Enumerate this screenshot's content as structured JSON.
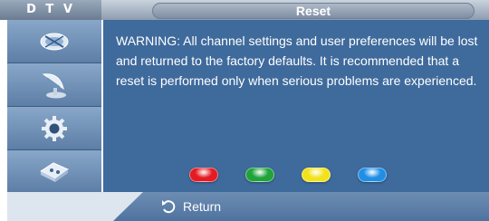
{
  "header": {
    "source_tab": "D T V",
    "title": "Reset"
  },
  "sidebar": {
    "items": [
      {
        "icon": "satellite-dish-icon"
      },
      {
        "icon": "antenna-icon"
      },
      {
        "icon": "gear-icon"
      },
      {
        "icon": "input-plug-icon"
      }
    ]
  },
  "main": {
    "warning_text": "WARNING: All channel settings and user preferences will be lost and returned to the factory defaults. It is recommended that a reset is performed only when serious problems are experienced."
  },
  "color_buttons": [
    {
      "name": "red",
      "color": "#e31b23"
    },
    {
      "name": "green",
      "color": "#1fa33a"
    },
    {
      "name": "yellow",
      "color": "#f2e21a"
    },
    {
      "name": "blue",
      "color": "#1f8fe6"
    }
  ],
  "footer": {
    "return_label": "Return",
    "return_icon": "return-arrow-icon"
  }
}
